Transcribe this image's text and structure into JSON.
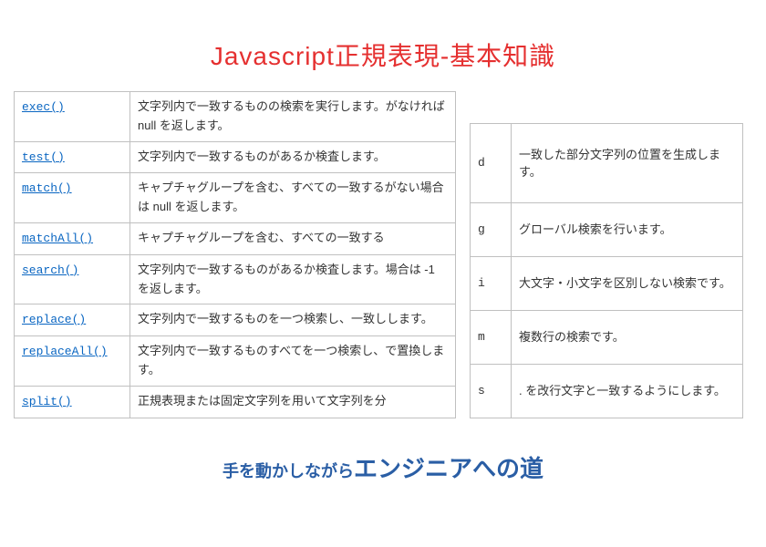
{
  "title": "Javascript正規表現-基本知識",
  "methods": [
    {
      "name": "exec()",
      "desc": "文字列内で一致するものの検索を実行します。がなければ null を返します。"
    },
    {
      "name": "test()",
      "desc": "文字列内で一致するものがあるか検査します。"
    },
    {
      "name": "match()",
      "desc": "キャプチャグループを含む、すべての一致するがない場合は null を返します。"
    },
    {
      "name": "matchAll()",
      "desc": "キャプチャグループを含む、すべての一致する"
    },
    {
      "name": "search()",
      "desc": "文字列内で一致するものがあるか検査します。場合は -1 を返します。"
    },
    {
      "name": "replace()",
      "desc": "文字列内で一致するものを一つ検索し、一致しします。"
    },
    {
      "name": "replaceAll()",
      "desc": "文字列内で一致するものすべてを一つ検索し、で置換します。"
    },
    {
      "name": "split()",
      "desc": "正規表現または固定文字列を用いて文字列を分"
    }
  ],
  "flags": [
    {
      "flag": "d",
      "desc": "一致した部分文字列の位置を生成します。"
    },
    {
      "flag": "g",
      "desc": "グローバル検索を行います。"
    },
    {
      "flag": "i",
      "desc": "大文字・小文字を区別しない検索です。"
    },
    {
      "flag": "m",
      "desc": "複数行の検索です。"
    },
    {
      "flag": "s",
      "desc": ". を改行文字と一致するようにします。"
    }
  ],
  "footer": {
    "part1": "手を動かしながら",
    "part2": "エンジニアへの道"
  }
}
